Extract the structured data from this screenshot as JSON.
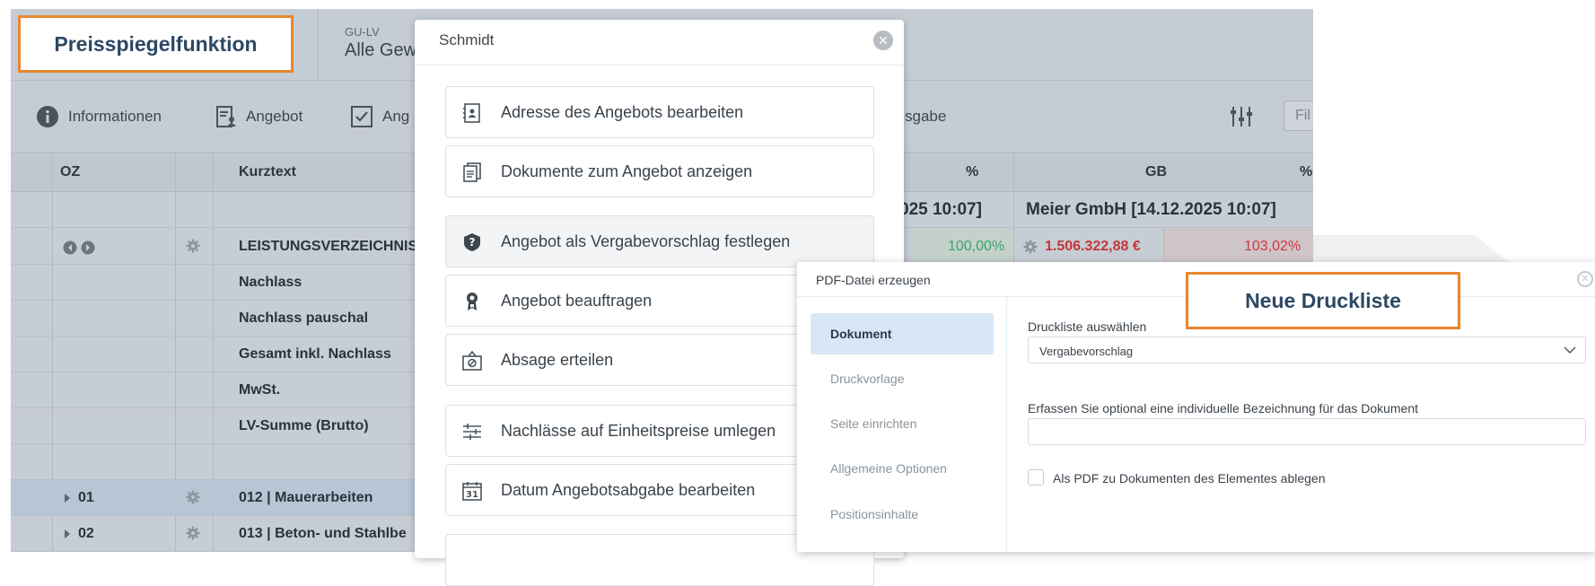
{
  "header": {
    "gu_label": "GU-LV",
    "gu_value": "Alle Gew"
  },
  "toolbar": {
    "informationen": "Informationen",
    "angebot": "Angebot",
    "ang": "Ang",
    "sgabe": "sgabe",
    "filter_placeholder": "Fil"
  },
  "grid": {
    "headers": {
      "oz": "OZ",
      "kurztext": "Kurztext",
      "pct1": "%",
      "gb": "GB",
      "pct2": "%"
    },
    "bieter_row": {
      "left_tail": "025 10:07]",
      "meier": "Meier GmbH [14.12.2025 10:07]"
    },
    "rows": [
      {
        "kurztext": "LEISTUNGSVERZEICHNIS",
        "pct1": "100,00%",
        "gb": "1.506.322,88 €",
        "pct2": "103,02%"
      },
      {
        "kurztext": "Nachlass"
      },
      {
        "kurztext": "Nachlass pauschal"
      },
      {
        "kurztext": "Gesamt inkl. Nachlass"
      },
      {
        "kurztext": "MwSt."
      },
      {
        "kurztext": "LV-Summe (Brutto)"
      },
      {
        "kurztext": ""
      },
      {
        "oz": "01",
        "kurztext": "012 | Mauerarbeiten"
      },
      {
        "oz": "02",
        "kurztext": "013 | Beton- und Stahlbe"
      }
    ]
  },
  "menu": {
    "title": "Schmidt",
    "items": [
      "Adresse des Angebots bearbeiten",
      "Dokumente zum Angebot anzeigen",
      "Angebot als Vergabevorschlag festlegen",
      "Angebot beauftragen",
      "Absage erteilen",
      "Nachlässe auf Einheitspreise umlegen",
      "Datum Angebotsabgabe bearbeiten"
    ],
    "calendar_day": "31"
  },
  "pdf_dialog": {
    "title": "PDF-Datei erzeugen",
    "nav": [
      "Dokument",
      "Druckvorlage",
      "Seite einrichten",
      "Allgemeine Optionen",
      "Positionsinhalte"
    ],
    "druckliste_label": "Druckliste auswählen",
    "druckliste_value": "Vergabevorschlag",
    "bezeichnung_label": "Erfassen Sie optional eine individuelle Bezeichnung für das Dokument",
    "checkbox_label": "Als PDF zu Dokumenten des Elementes ablegen"
  },
  "callouts": {
    "preisspiegel": "Preisspiegelfunktion",
    "neue_druckliste": "Neue Druckliste"
  },
  "colors": {
    "accent_orange": "#e8862f",
    "positive_green": "#3aa46a",
    "negative_red": "#d0393c",
    "selected_blue": "#d7e7f6"
  }
}
